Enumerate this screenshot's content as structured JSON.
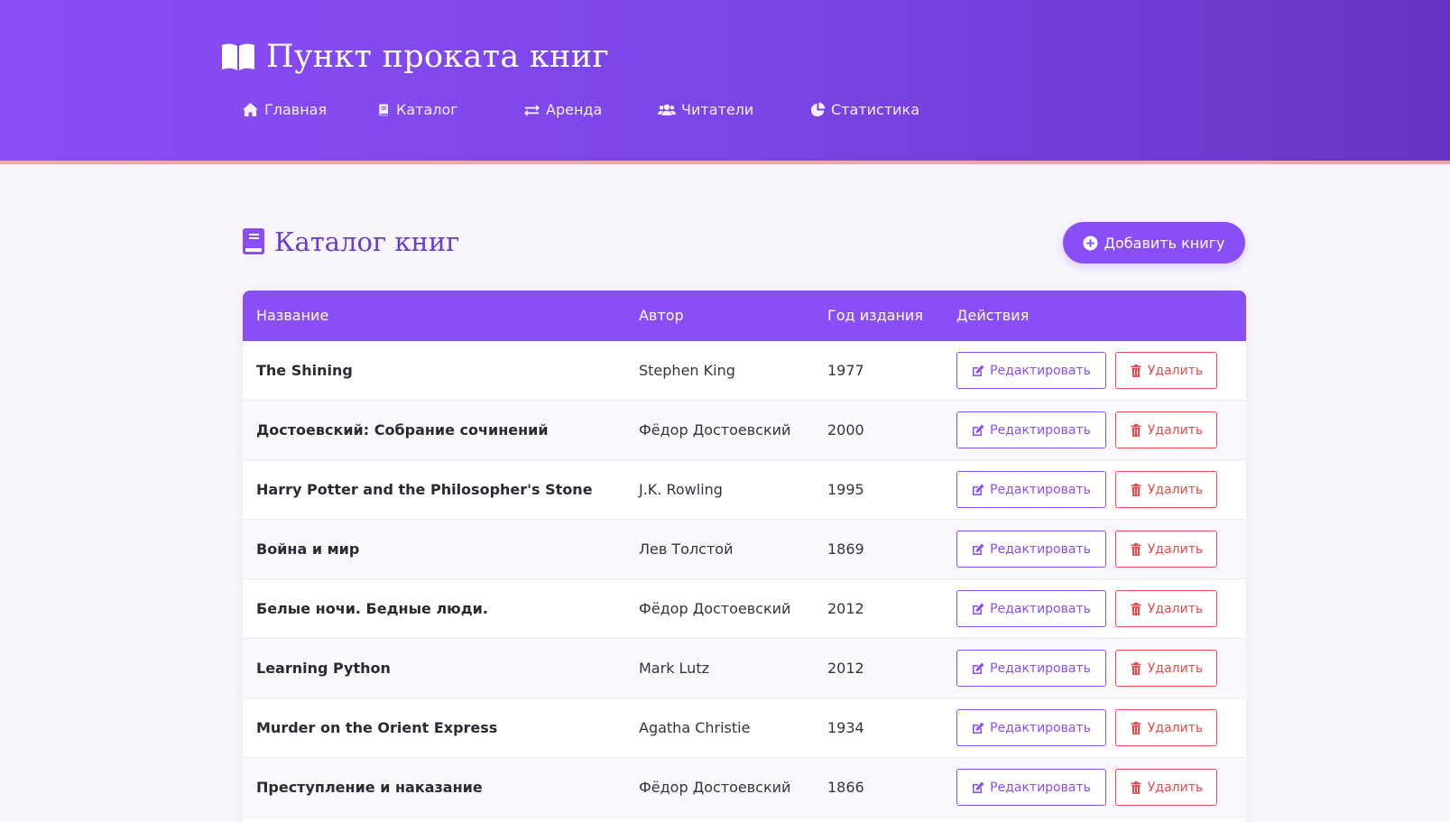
{
  "app": {
    "title": "Пункт проката книг"
  },
  "nav": {
    "items": [
      {
        "label": "Главная",
        "icon": "home-icon"
      },
      {
        "label": "Каталог",
        "icon": "book-icon"
      },
      {
        "label": "Аренда",
        "icon": "exchange-icon"
      },
      {
        "label": "Читатели",
        "icon": "users-icon"
      },
      {
        "label": "Статистика",
        "icon": "pie-chart-icon"
      }
    ]
  },
  "main": {
    "title": "Каталог книг",
    "add_button_label": "Добавить книгу"
  },
  "table": {
    "columns": [
      "Название",
      "Автор",
      "Год издания",
      "Действия"
    ],
    "edit_label": "Редактировать",
    "delete_label": "Удалить",
    "rows": [
      {
        "title": "The Shining",
        "author": "Stephen King",
        "year": "1977"
      },
      {
        "title": "Достоевский: Собрание сочинений",
        "author": "Фёдор Достоевский",
        "year": "2000"
      },
      {
        "title": "Harry Potter and the Philosopher's Stone",
        "author": "J.K. Rowling",
        "year": "1995"
      },
      {
        "title": "Война и мир",
        "author": "Лев Толстой",
        "year": "1869"
      },
      {
        "title": "Белые ночи. Бедные люди.",
        "author": "Фёдор Достоевский",
        "year": "2012"
      },
      {
        "title": "Learning Python",
        "author": "Mark Lutz",
        "year": "2012"
      },
      {
        "title": "Murder on the Orient Express",
        "author": "Agatha Christie",
        "year": "1934"
      },
      {
        "title": "Преступление и наказание",
        "author": "Фёдор Достоевский",
        "year": "1866"
      }
    ]
  },
  "colors": {
    "accent": "#8a4ef6",
    "header_end": "#6634c4",
    "danger": "#ea4a4a",
    "title": "#6a3ccc",
    "background": "#f8f6fc"
  }
}
